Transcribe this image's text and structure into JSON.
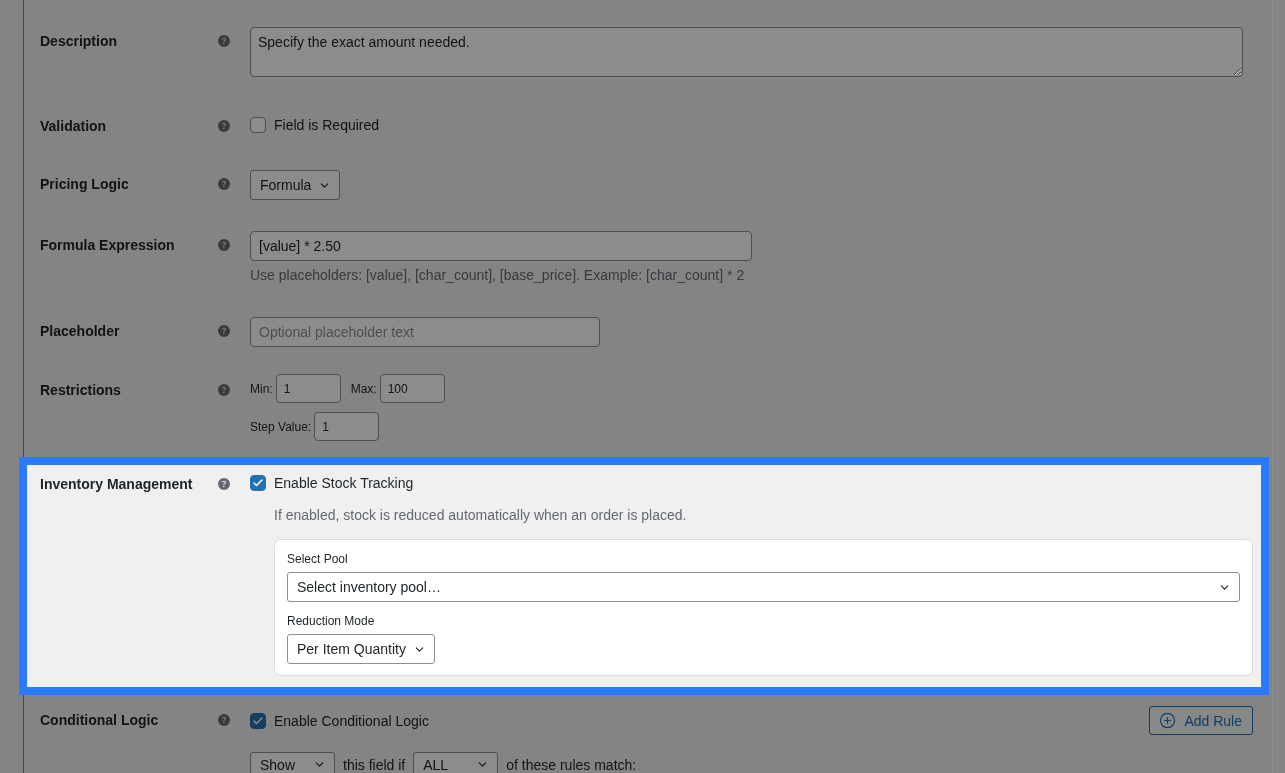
{
  "fields": [
    {
      "kind": "textarea",
      "label": "Description",
      "highlighted": false,
      "value": "Specify the exact amount needed."
    },
    {
      "kind": "checkbox",
      "label": "Validation",
      "highlighted": false,
      "option": "Field is Required",
      "checked": false
    },
    {
      "kind": "select",
      "label": "Pricing Logic",
      "highlighted": false,
      "value": "Formula"
    },
    {
      "kind": "expression",
      "label": "Formula Expression",
      "highlighted": false,
      "value": "[value] * 2.50",
      "hint": "Use placeholders: [value], [char_count], [base_price]. Example: [char_count] * 2"
    },
    {
      "kind": "text",
      "label": "Placeholder",
      "highlighted": false,
      "placeholder": "Optional placeholder text"
    },
    {
      "kind": "numbers",
      "label": "Restrictions",
      "highlighted": false,
      "lines": [
        {
          "inputs": [
            {
              "label": "Min:",
              "value": "1"
            },
            {
              "label": "Max:",
              "value": "100"
            }
          ]
        },
        {
          "inputs": [
            {
              "label": "Step Value:",
              "value": "1"
            }
          ]
        }
      ]
    },
    {
      "kind": "inventory",
      "label": "Inventory Management",
      "highlighted": true,
      "option": "Enable Stock Tracking",
      "checked": true,
      "hint": "If enabled, stock is reduced automatically when an order is placed.",
      "pool": {
        "label": "Select Pool",
        "value": "Select inventory pool…"
      },
      "reduction_mode": {
        "label": "Reduction Mode",
        "value": "Per Item Quantity"
      }
    },
    {
      "kind": "conditional",
      "label": "Conditional Logic",
      "highlighted": false,
      "option": "Enable Conditional Logic",
      "checked": true,
      "button": "Add Rule",
      "rule": {
        "action": "Show",
        "connector": "this field if",
        "match": "ALL",
        "suffix": "of these rules match:"
      }
    }
  ]
}
